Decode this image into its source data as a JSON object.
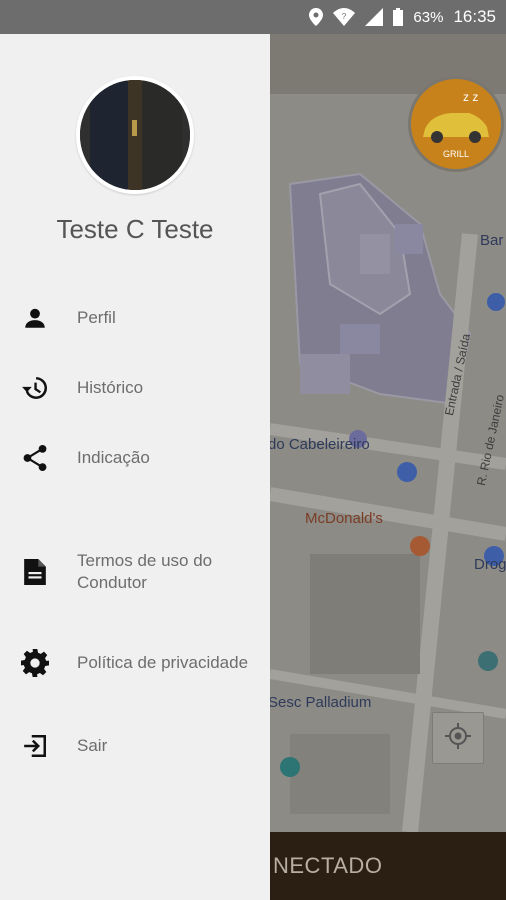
{
  "status_bar": {
    "battery_percent": "63%",
    "time": "16:35"
  },
  "user": {
    "name": "Teste C Teste"
  },
  "menu": [
    {
      "label": "Perfil",
      "icon": "person-icon"
    },
    {
      "label": "Histórico",
      "icon": "history-icon"
    },
    {
      "label": "Indicação",
      "icon": "share-icon"
    },
    {
      "label": "Termos de uso do Condutor",
      "icon": "document-icon"
    },
    {
      "label": "Política de privacidade",
      "icon": "gear-icon"
    },
    {
      "label": "Sair",
      "icon": "exit-icon"
    }
  ],
  "map": {
    "places": [
      "Bar",
      "do Cabeleireiro",
      "McDonald's",
      "Drog",
      "Sesc Palladium"
    ],
    "roads": [
      "R. Rio de Janeiro",
      "Entrada / Saída"
    ]
  },
  "app_logo": {
    "text": "GRILL"
  },
  "bottom_bar": {
    "status": "NECTADO"
  },
  "colors": {
    "drawer_bg": "#f0f0f0",
    "map_overlay": "#8d8b86",
    "bottom_bar": "#2a1f12",
    "logo": "#c7821b"
  }
}
